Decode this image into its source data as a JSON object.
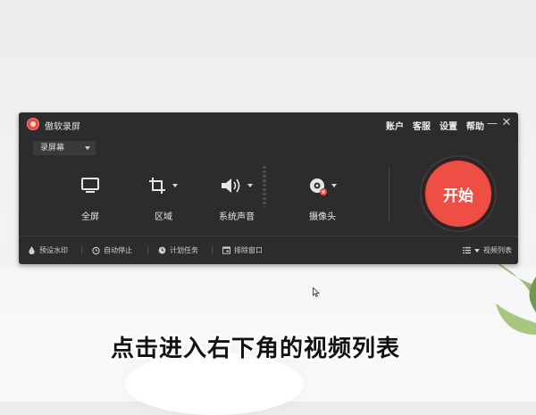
{
  "app": {
    "title": "傲软录屏"
  },
  "menu": {
    "account": "账户",
    "support": "客服",
    "settings": "设置",
    "help": "帮助"
  },
  "window_controls": {
    "minimize": "—",
    "close": "✕"
  },
  "mode_select": {
    "value": "录屏幕"
  },
  "tools": {
    "fullscreen": {
      "label": "全屏",
      "icon": "monitor-icon"
    },
    "region": {
      "label": "区域",
      "icon": "crop-icon"
    },
    "system_audio": {
      "label": "系统声音",
      "icon": "speaker-icon"
    },
    "camera": {
      "label": "摄像头",
      "icon": "webcam-icon"
    }
  },
  "start_button": {
    "label": "开始",
    "color": "#ee4e43"
  },
  "bottom_bar": {
    "watermark": "预设水印",
    "auto_stop": "自动停止",
    "schedule": "计划任务",
    "exclude_window": "排除窗口",
    "video_list": "视频列表"
  },
  "caption": "点击进入右下角的视频列表"
}
